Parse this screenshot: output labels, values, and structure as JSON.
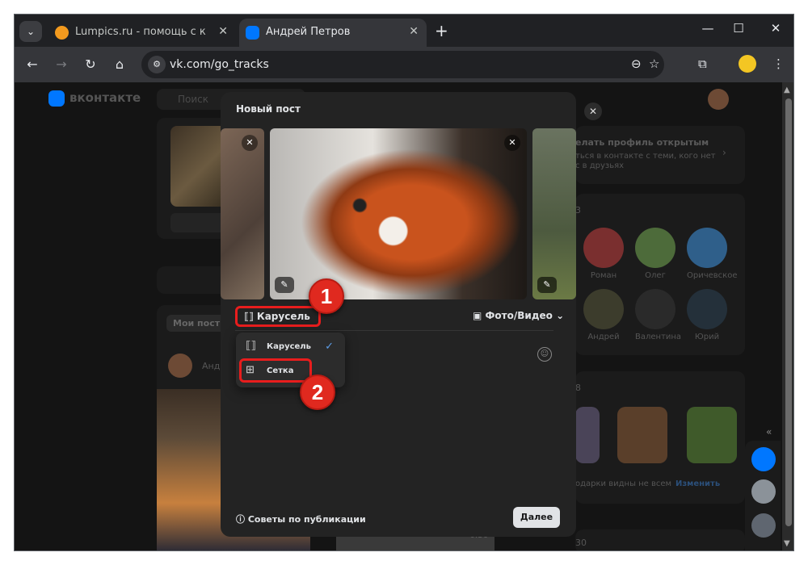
{
  "browser": {
    "tabs": [
      {
        "title": "Lumpics.ru - помощь с компь",
        "favicon": "orange-circle-icon",
        "active": false
      },
      {
        "title": "Андрей Петров",
        "favicon": "vk-icon",
        "active": true
      }
    ],
    "new_tab": "+",
    "url": "vk.com/go_tracks"
  },
  "vk": {
    "logo_text": "вконтакте",
    "search_placeholder": "Поиск",
    "left_feed": {
      "my_posts": "Мои посты",
      "author": "Анд"
    },
    "profile_banner": {
      "title": "елать профиль открытым",
      "subtitle": "ться в контакте с теми, кого нет",
      "subtitle2": "с в друзьях"
    },
    "friends": [
      {
        "name": "Роман"
      },
      {
        "name": "Олег"
      },
      {
        "name": "Оричевское"
      },
      {
        "name": "Андрей"
      },
      {
        "name": "Валентина"
      },
      {
        "name": "Юрий"
      }
    ],
    "friends_count": "3",
    "gifts_count": "8",
    "gifts_note": "одарки видны не всем",
    "gifts_change": "Изменить",
    "bottom_count": "30",
    "video_duration": "0:36"
  },
  "modal": {
    "title": "Новый пост",
    "mode_button": "Карусель",
    "media_button": "Фото/Видео",
    "dropdown": [
      {
        "label": "Карусель",
        "checked": true
      },
      {
        "label": "Сетка",
        "checked": false
      }
    ],
    "tips": "Советы по публикации",
    "next": "Далее"
  },
  "callouts": [
    "1",
    "2"
  ],
  "colors": {
    "highlight": "#e81d1d",
    "vk_blue": "#0077ff"
  }
}
